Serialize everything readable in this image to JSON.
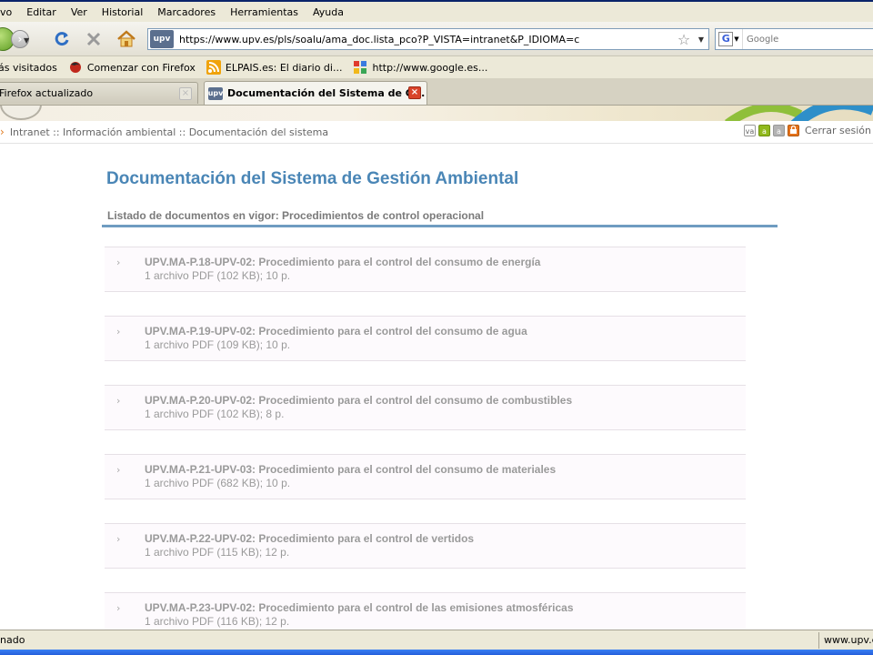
{
  "browser": {
    "menu": [
      "vo",
      "Editar",
      "Ver",
      "Historial",
      "Marcadores",
      "Herramientas",
      "Ayuda"
    ],
    "url": "https://www.upv.es/pls/soalu/ama_doc.lista_pco?P_VISTA=intranet&P_IDIOMA=c",
    "site_icon": "upv",
    "search_placeholder": "Google",
    "bookmarks": [
      {
        "label": "ás visitados",
        "icon": "none"
      },
      {
        "label": "Comenzar con Firefox",
        "icon": "firefox-icon"
      },
      {
        "label": "ELPAIS.es: El diario di...",
        "icon": "rss-icon"
      },
      {
        "label": "http://www.google.es...",
        "icon": "google-icon"
      }
    ],
    "tabs": [
      {
        "label": "Firefox actualizado",
        "active": false
      },
      {
        "label": "Documentación del Sistema de G...",
        "active": true,
        "favicon": "upv"
      }
    ],
    "status_left": "nado",
    "status_right": "www.upv.es"
  },
  "page": {
    "breadcrumb": "Intranet :: Información ambiental :: Documentación del sistema",
    "tool_icons": [
      "va",
      "a",
      "a",
      "lock"
    ],
    "logout": "Cerrar sesión",
    "title": "Documentación del Sistema de Gestión Ambiental",
    "list_heading": "Listado de documentos en vigor: Procedimientos de control operacional",
    "documents": [
      {
        "name": "UPV.MA-P.18-UPV-02: Procedimiento para el control del consumo de energía",
        "meta": "1 archivo PDF (102 KB); 10 p."
      },
      {
        "name": "UPV.MA-P.19-UPV-02: Procedimiento para el control del consumo de agua",
        "meta": "1 archivo PDF (109 KB); 10 p."
      },
      {
        "name": "UPV.MA-P.20-UPV-02: Procedimiento para el control del consumo de combustibles",
        "meta": "1 archivo PDF (102 KB); 8 p."
      },
      {
        "name": "UPV.MA-P.21-UPV-03: Procedimiento para el control del consumo de materiales",
        "meta": "1 archivo PDF (682 KB); 10 p."
      },
      {
        "name": "UPV.MA-P.22-UPV-02: Procedimiento para el control de vertidos",
        "meta": "1 archivo PDF (115 KB); 12 p."
      },
      {
        "name": "UPV.MA-P.23-UPV-02: Procedimiento para el control de las emisiones atmosféricas",
        "meta": "1 archivo PDF (116 KB); 12 p."
      }
    ]
  }
}
